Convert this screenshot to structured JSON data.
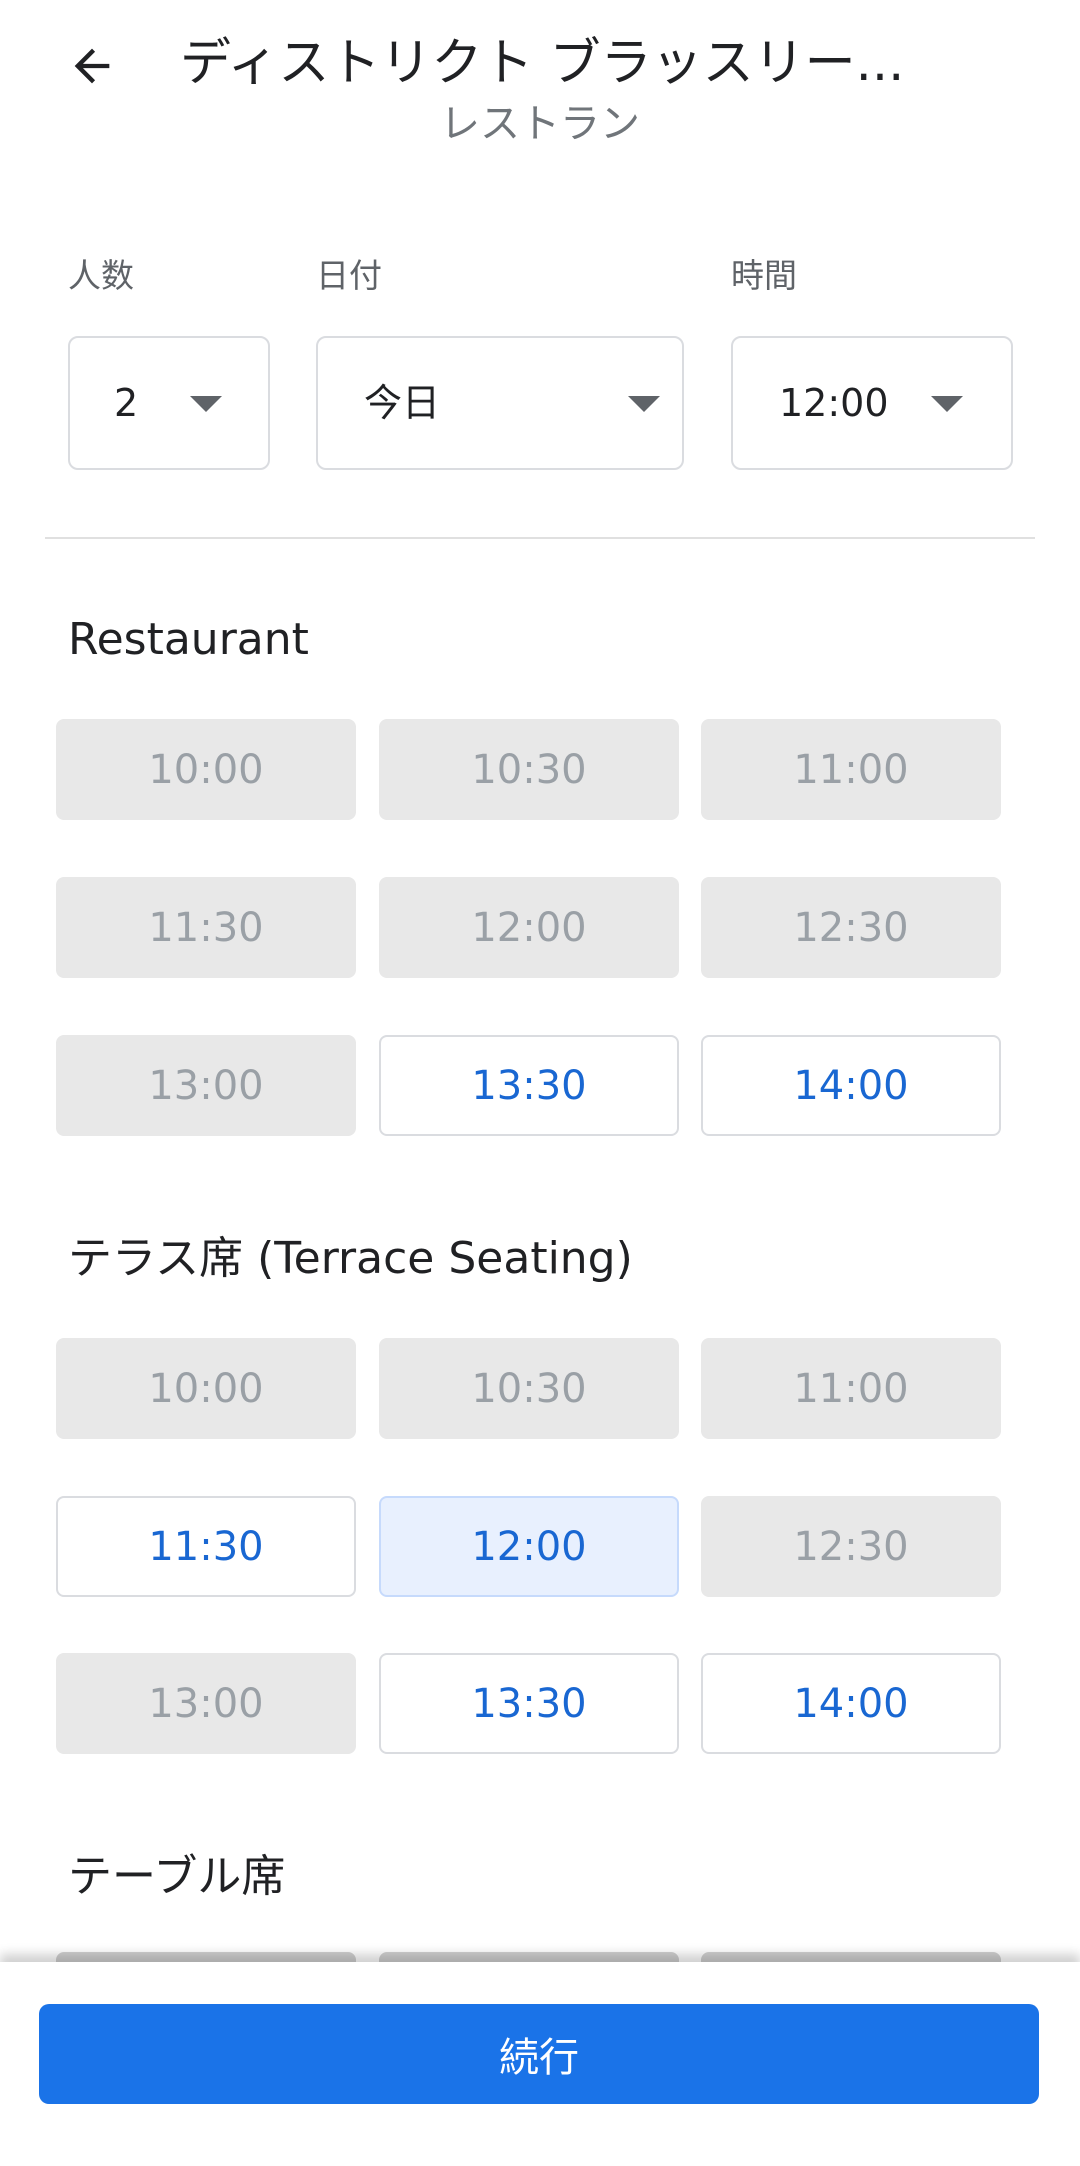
{
  "header": {
    "back_icon": "arrow-left-icon",
    "title": "ディストリクト ブラッスリー...",
    "subtitle": "レストラン"
  },
  "booking": {
    "party": {
      "label": "人数",
      "value": "2"
    },
    "date": {
      "label": "日付",
      "value": "今日"
    },
    "time": {
      "label": "時間",
      "value": "12:00"
    }
  },
  "sections": [
    {
      "title": "Restaurant",
      "slots": [
        {
          "time": "10:00",
          "state": "disabled"
        },
        {
          "time": "10:30",
          "state": "disabled"
        },
        {
          "time": "11:00",
          "state": "disabled"
        },
        {
          "time": "11:30",
          "state": "disabled"
        },
        {
          "time": "12:00",
          "state": "disabled"
        },
        {
          "time": "12:30",
          "state": "disabled"
        },
        {
          "time": "13:00",
          "state": "disabled"
        },
        {
          "time": "13:30",
          "state": "available"
        },
        {
          "time": "14:00",
          "state": "available"
        }
      ]
    },
    {
      "title": "テラス席 (Terrace Seating)",
      "slots": [
        {
          "time": "10:00",
          "state": "disabled"
        },
        {
          "time": "10:30",
          "state": "disabled"
        },
        {
          "time": "11:00",
          "state": "disabled"
        },
        {
          "time": "11:30",
          "state": "available"
        },
        {
          "time": "12:00",
          "state": "selected"
        },
        {
          "time": "12:30",
          "state": "disabled"
        },
        {
          "time": "13:00",
          "state": "disabled"
        },
        {
          "time": "13:30",
          "state": "available"
        },
        {
          "time": "14:00",
          "state": "available"
        }
      ]
    },
    {
      "title": "テーブル席",
      "slots": []
    }
  ],
  "footer": {
    "continue_label": "続行"
  },
  "colors": {
    "accent": "#1a73e8",
    "slot_text": "#1967d2",
    "selected_bg": "#e8f0fe",
    "disabled_bg": "#e8e8e8",
    "disabled_text": "#9aa0a6"
  }
}
